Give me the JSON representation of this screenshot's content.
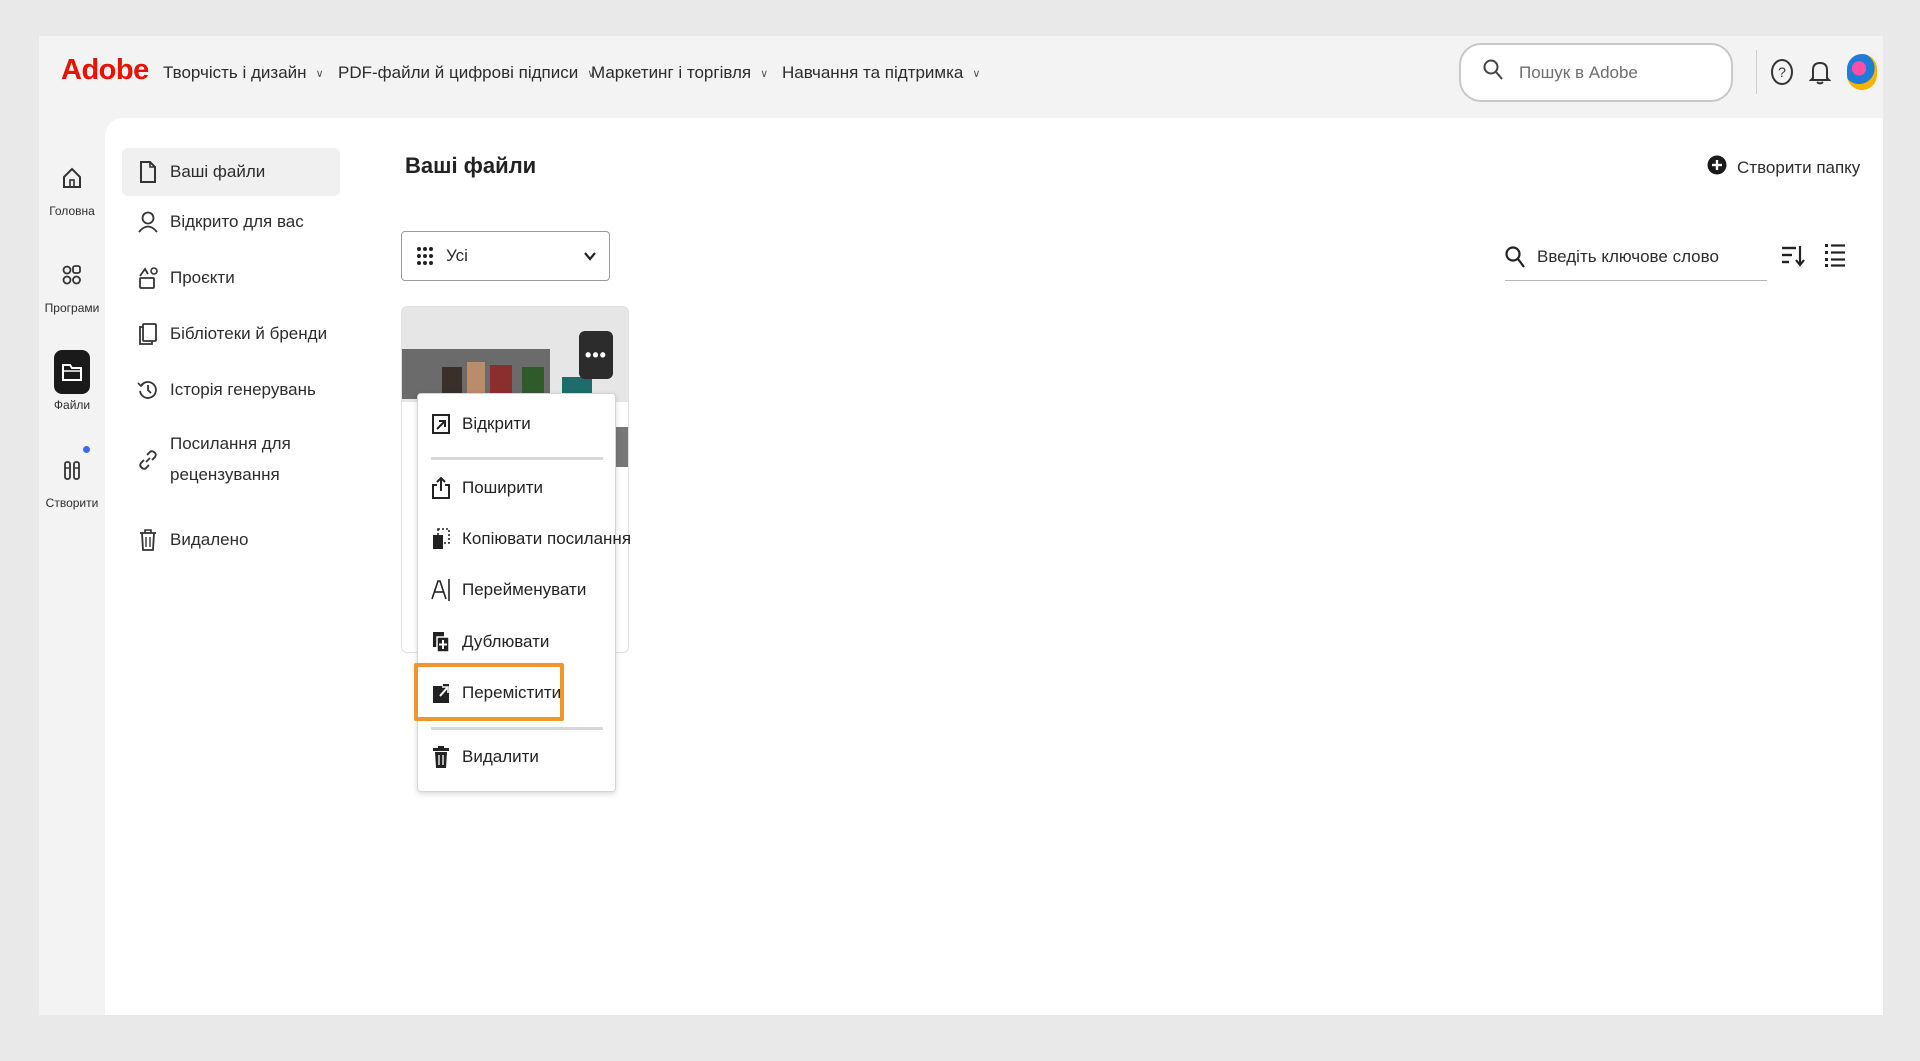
{
  "topbar": {
    "logo": "Adobe",
    "nav": [
      {
        "label": "Творчість і дизайн"
      },
      {
        "label": "PDF-файли й цифрові підписи"
      },
      {
        "label": "Маркетинг і торгівля"
      },
      {
        "label": "Навчання та підтримка"
      }
    ],
    "search_placeholder": "Пошук в Adobe"
  },
  "rail": {
    "items": [
      {
        "label": "Головна",
        "icon": "home-icon"
      },
      {
        "label": "Програми",
        "icon": "apps-icon"
      },
      {
        "label": "Файли",
        "icon": "folder-icon"
      },
      {
        "label": "Створити",
        "icon": "create-icon"
      }
    ]
  },
  "sidenav": {
    "items": [
      {
        "label": "Ваші файли",
        "icon": "file-icon"
      },
      {
        "label": "Відкрито для вас",
        "icon": "user-icon"
      },
      {
        "label": "Проєкти",
        "icon": "projects-icon"
      },
      {
        "label": "Бібліотеки й бренди",
        "icon": "library-icon"
      },
      {
        "label": "Історія генерувань",
        "icon": "history-icon"
      },
      {
        "label": "Посилання для",
        "label2": "рецензування",
        "icon": "link-icon"
      },
      {
        "label": "Видалено",
        "icon": "trash-icon"
      }
    ]
  },
  "main": {
    "title": "Ваші файли",
    "create_folder": "Створити папку",
    "filter_value": "Усі",
    "keyword_placeholder": "Введіть ключове слово"
  },
  "context_menu": {
    "items": [
      {
        "label": "Відкрити",
        "icon": "open-icon"
      },
      {
        "label": "Поширити",
        "icon": "share-icon"
      },
      {
        "label": "Копіювати посилання",
        "icon": "copy-link-icon"
      },
      {
        "label": "Перейменувати",
        "icon": "rename-icon"
      },
      {
        "label": "Дублювати",
        "icon": "duplicate-icon"
      },
      {
        "label": "Перемістити",
        "icon": "move-icon"
      },
      {
        "label": "Видалити",
        "icon": "delete-icon"
      }
    ]
  },
  "colors": {
    "brand": "#eb1000",
    "highlight": "#f0962a",
    "notification_dot": "#3c6af5"
  }
}
